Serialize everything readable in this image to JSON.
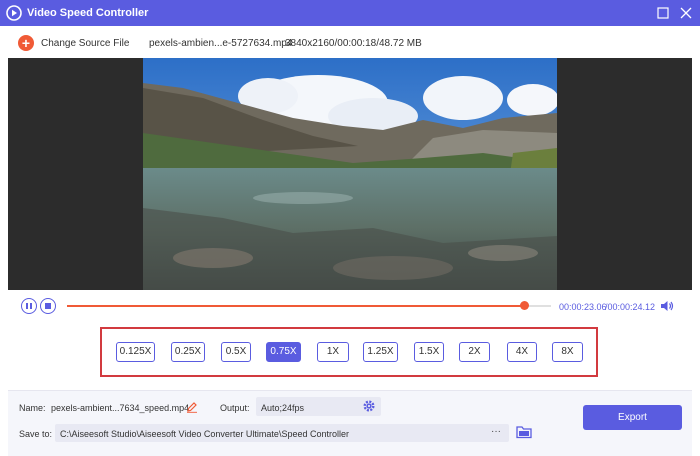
{
  "window": {
    "title": "Video Speed Controller",
    "accent_color": "#5a5ce0",
    "logo_icon": "app-logo-icon",
    "maximize_icon": "maximize-icon",
    "close_icon": "close-icon"
  },
  "toolbar": {
    "add_icon": "plus-icon",
    "add_label": "+",
    "change_source_label": "Change Source File",
    "file_name": "pexels-ambien...e-5727634.mp4",
    "file_meta": "3840x2160/00:00:18/48.72 MB"
  },
  "player": {
    "pause_icon": "pause-icon",
    "stop_icon": "stop-icon",
    "volume_icon": "volume-icon",
    "progress_fraction": 0.944,
    "current_time": "00:00:23.06",
    "separator": "/",
    "total_time": "00:00:24.12",
    "progress_color": "#f05a36"
  },
  "speeds": {
    "options": [
      "0.125X",
      "0.25X",
      "0.5X",
      "0.75X",
      "1X",
      "1.25X",
      "1.5X",
      "2X",
      "4X",
      "8X"
    ],
    "selected": "0.75X",
    "highlight_border_color": "#d23a3f"
  },
  "footer": {
    "name_label": "Name:",
    "name_value": "pexels-ambient...7634_speed.mp4",
    "edit_icon": "pencil-icon",
    "output_label": "Output:",
    "output_value": "Auto;24fps",
    "settings_icon": "gear-icon",
    "save_label": "Save to:",
    "save_path": "C:\\Aiseesoft Studio\\Aiseesoft Video Converter Ultimate\\Speed Controller",
    "browse_label": "···",
    "folder_icon": "folder-icon",
    "export_label": "Export"
  }
}
